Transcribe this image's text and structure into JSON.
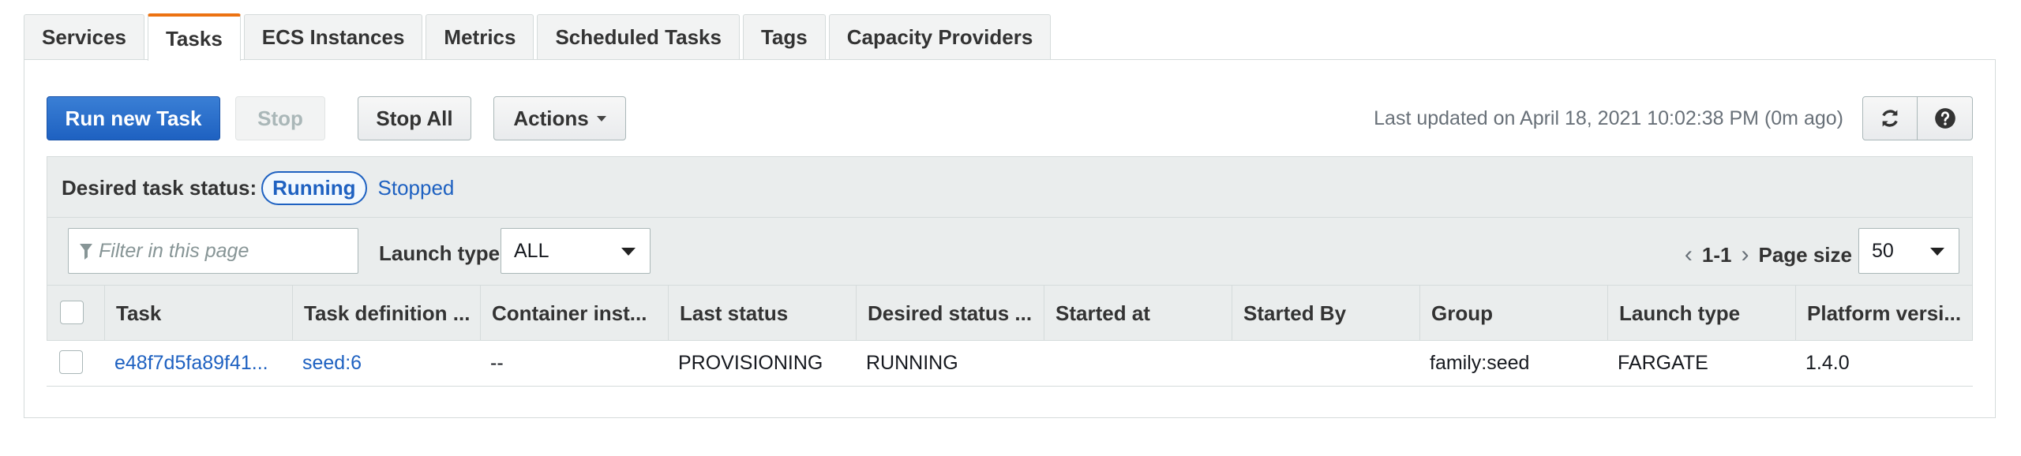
{
  "tabs": [
    {
      "label": "Services",
      "active": false
    },
    {
      "label": "Tasks",
      "active": true
    },
    {
      "label": "ECS Instances",
      "active": false
    },
    {
      "label": "Metrics",
      "active": false
    },
    {
      "label": "Scheduled Tasks",
      "active": false
    },
    {
      "label": "Tags",
      "active": false
    },
    {
      "label": "Capacity Providers",
      "active": false
    }
  ],
  "toolbar": {
    "run_new_task": "Run new Task",
    "stop": "Stop",
    "stop_all": "Stop All",
    "actions": "Actions",
    "last_updated": "Last updated on April 18, 2021 10:02:38 PM (0m ago)",
    "refresh_icon": "refresh-icon",
    "help_icon": "help-icon"
  },
  "status_filter": {
    "label": "Desired task status:",
    "running": "Running",
    "stopped": "Stopped"
  },
  "filter": {
    "placeholder": "Filter in this page",
    "launch_type_label": "Launch type",
    "launch_type_value": "ALL",
    "pagination": "1-1",
    "page_size_label": "Page size",
    "page_size_value": "50"
  },
  "table": {
    "columns": [
      "Task",
      "Task definition ...",
      "Container inst...",
      "Last status",
      "Desired status ...",
      "Started at",
      "Started By",
      "Group",
      "Launch type",
      "Platform versi..."
    ],
    "rows": [
      {
        "task": "e48f7d5fa89f41...",
        "task_definition": "seed:6",
        "container_instance": "--",
        "last_status": "PROVISIONING",
        "desired_status": "RUNNING",
        "started_at": "",
        "started_by": "",
        "group": "family:seed",
        "launch_type": "FARGATE",
        "platform_version": "1.4.0"
      }
    ]
  },
  "colors": {
    "accent": "#ec7211",
    "primary": "#1e61c1",
    "link": "#1e61c1"
  }
}
